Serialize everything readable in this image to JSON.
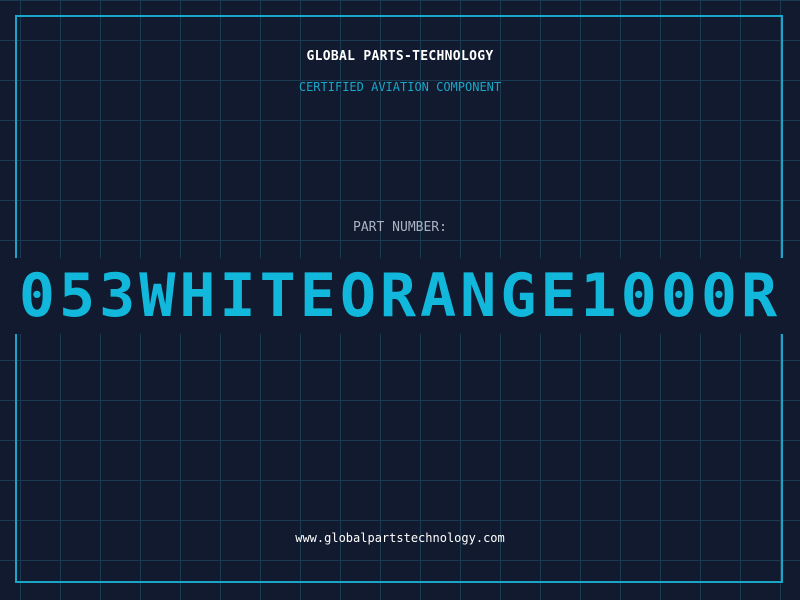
{
  "label": {
    "company": "GLOBAL PARTS-TECHNOLOGY",
    "subtitle": "CERTIFIED AVIATION COMPONENT",
    "part_number_label": "PART NUMBER:",
    "part_number_value": "053WHITEORANGE1000R",
    "website": "www.globalpartstechnology.com"
  },
  "colors": {
    "background": "#111a2f",
    "grid": "#1b3b52",
    "accent": "#1aa6c8",
    "part_number": "#12b8db",
    "text": "#ffffff",
    "muted": "#a8b4c4"
  }
}
